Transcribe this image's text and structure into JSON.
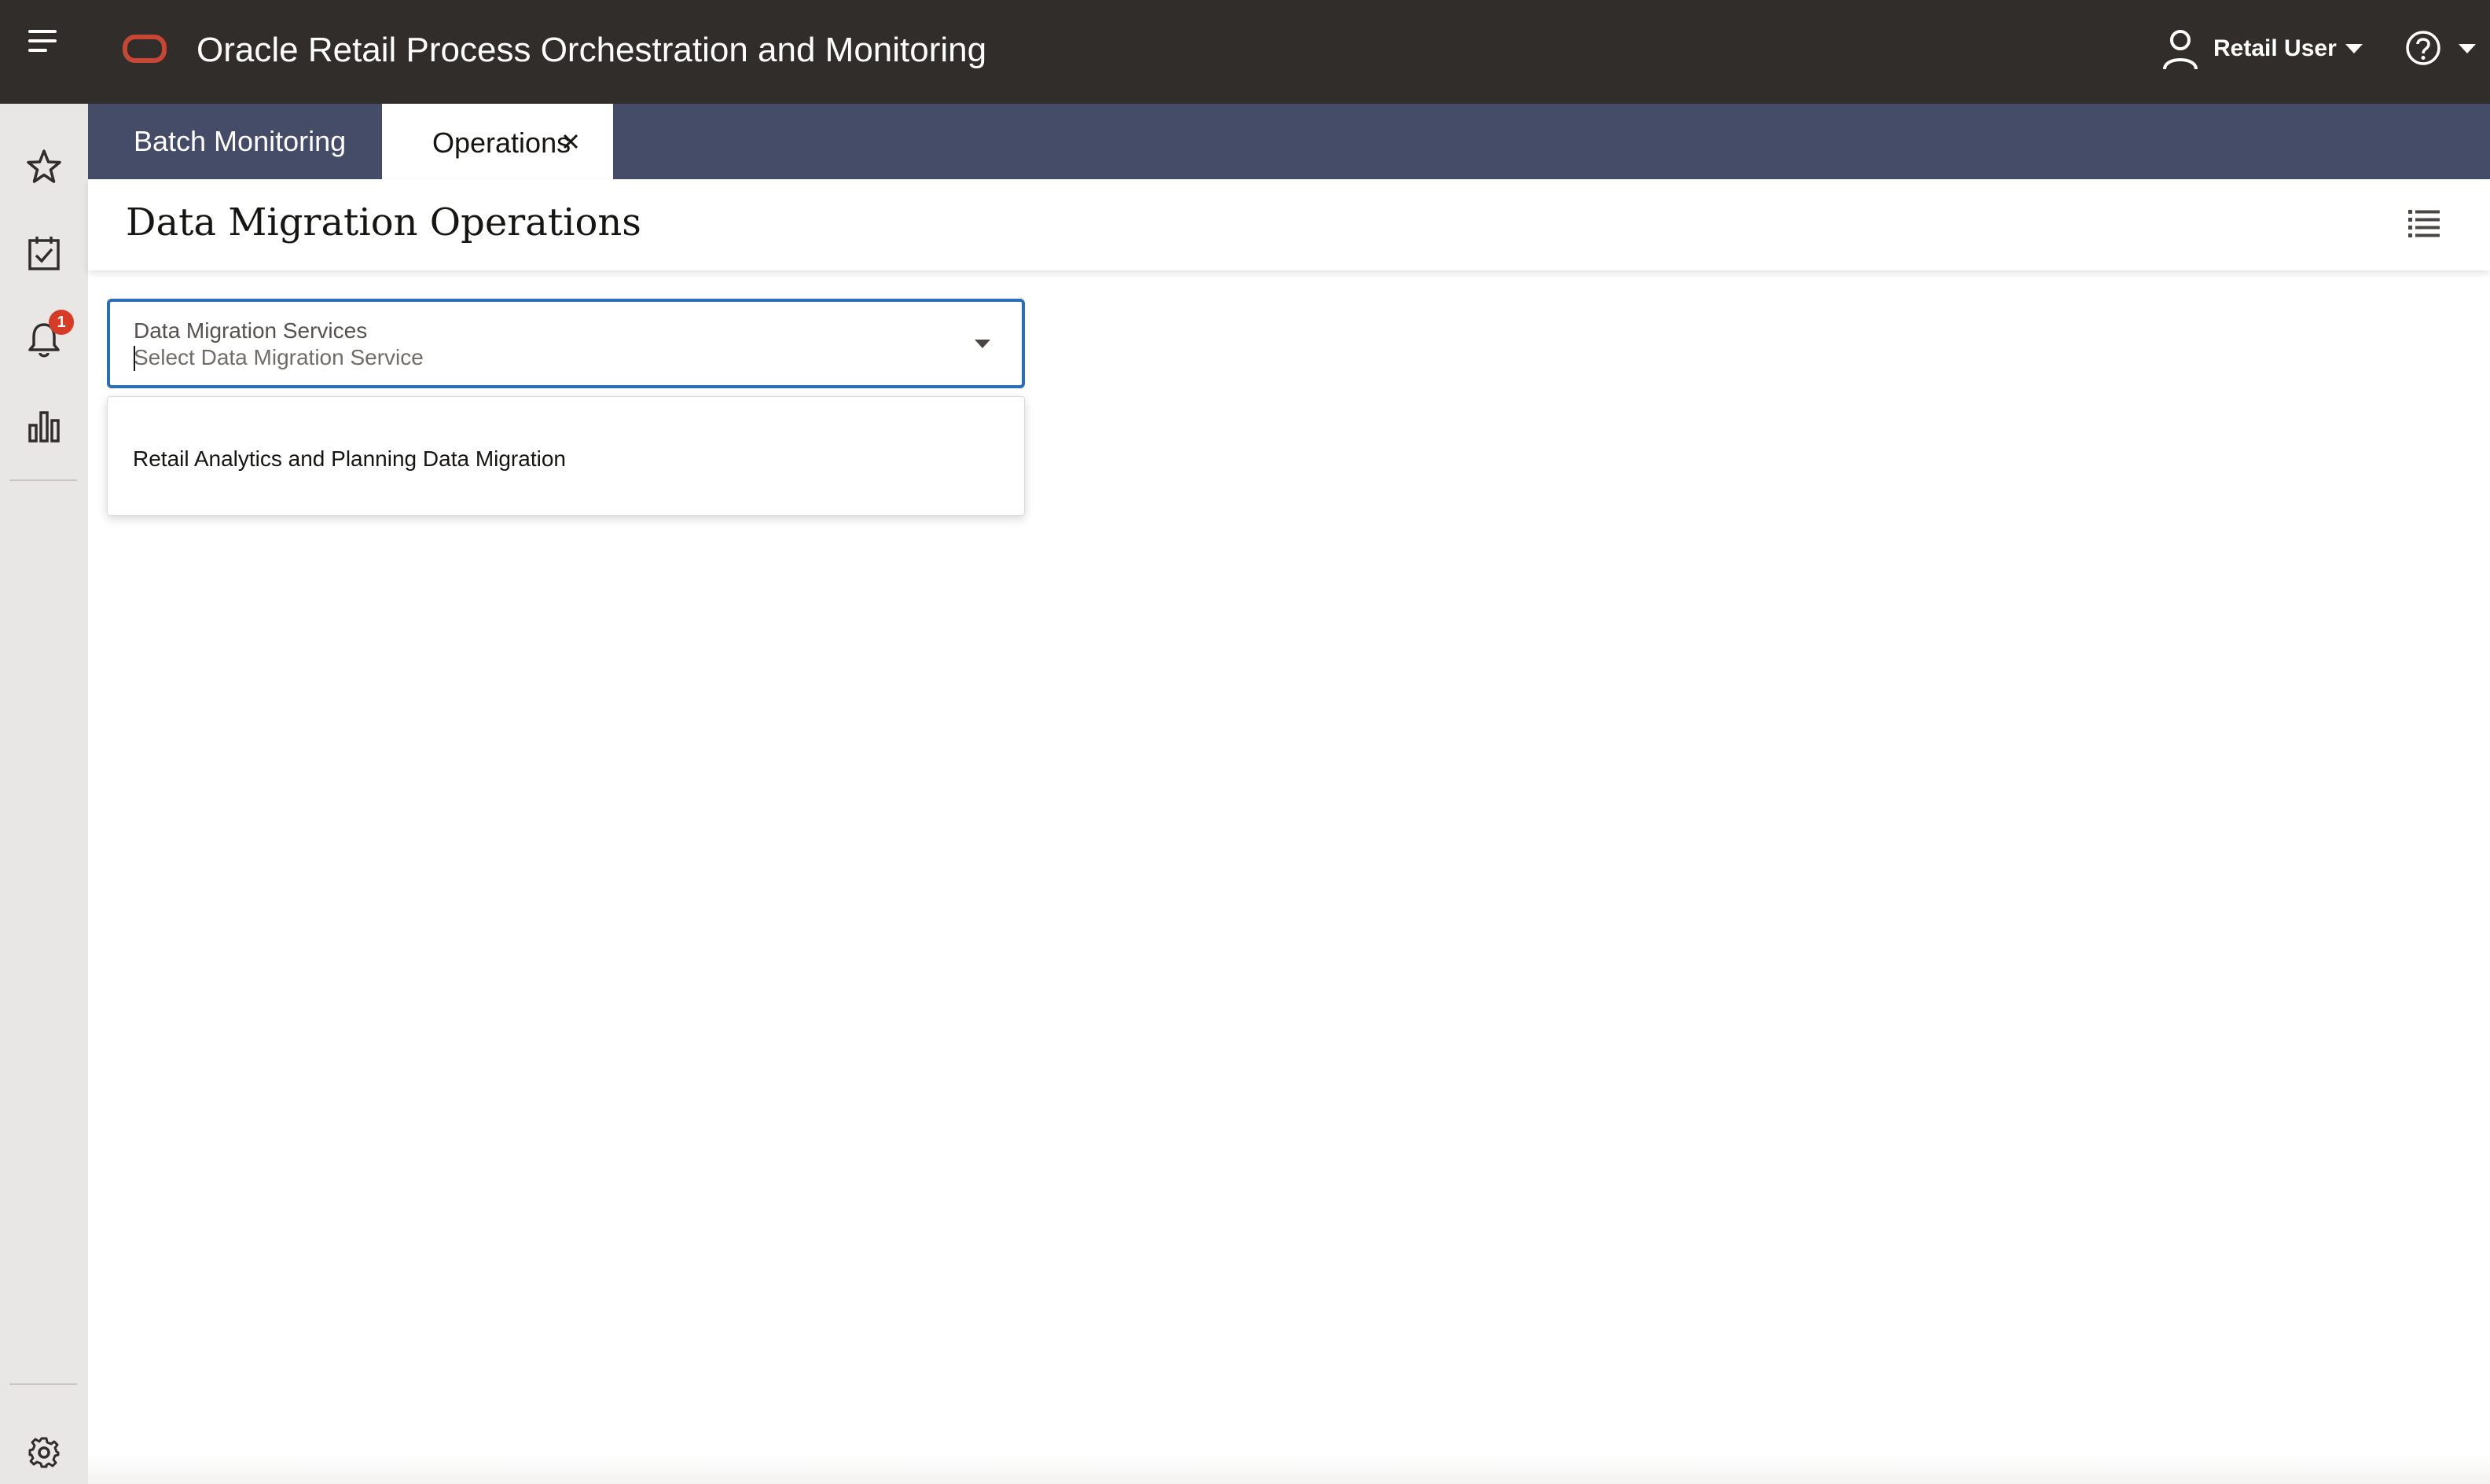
{
  "header": {
    "app_title": "Oracle Retail Process Orchestration and Monitoring",
    "user_name": "Retail User",
    "icons": {
      "menu": "hamburger-menu-icon",
      "logo": "oracle-logo",
      "user": "user-icon",
      "user_menu": "chevron-down-icon",
      "help": "help-icon",
      "help_menu": "chevron-down-icon"
    }
  },
  "rail": {
    "items": [
      {
        "name": "favorites",
        "icon": "star-icon"
      },
      {
        "name": "tasks",
        "icon": "calendar-check-icon"
      },
      {
        "name": "notifications",
        "icon": "bell-icon",
        "badge": "1"
      },
      {
        "name": "dashboard",
        "icon": "bar-chart-icon"
      },
      {
        "name": "settings",
        "icon": "gear-icon"
      }
    ]
  },
  "tabs": [
    {
      "label": "Batch Monitoring",
      "active": false
    },
    {
      "label": "Operations",
      "active": true,
      "closable": true
    }
  ],
  "page": {
    "title": "Data Migration Operations",
    "view_icon": "list-view-icon"
  },
  "select": {
    "label": "Data Migration Services",
    "placeholder": "Select Data Migration Service",
    "expanded": true,
    "options": [
      "Retail Analytics and Planning Data Migration"
    ]
  },
  "colors": {
    "header_bg": "#312d2a",
    "tab_strip_bg": "#444c68",
    "rail_bg": "#e9e7e5",
    "focus_border": "#2b6db8",
    "brand_red": "#c74634",
    "badge_red": "#d63b25"
  }
}
